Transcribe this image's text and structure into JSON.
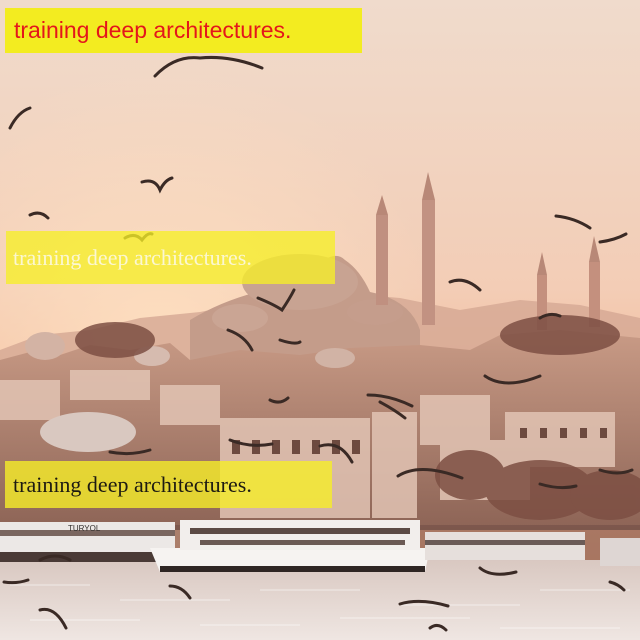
{
  "photo": {
    "subject": "istanbul-skyline-with-mosque-ferries-and-seagulls",
    "palette": {
      "sky_top": "#f1dccd",
      "sky_horizon": "#f6b08a",
      "city": "#b98d7c",
      "water": "#e8dcd7",
      "sun_glow": "#ffd9b8"
    }
  },
  "captions": {
    "top": "training deep architectures.",
    "middle": "training deep architectures.",
    "bottom": "training deep architectures."
  },
  "ferry": {
    "name": "TURYOL"
  }
}
